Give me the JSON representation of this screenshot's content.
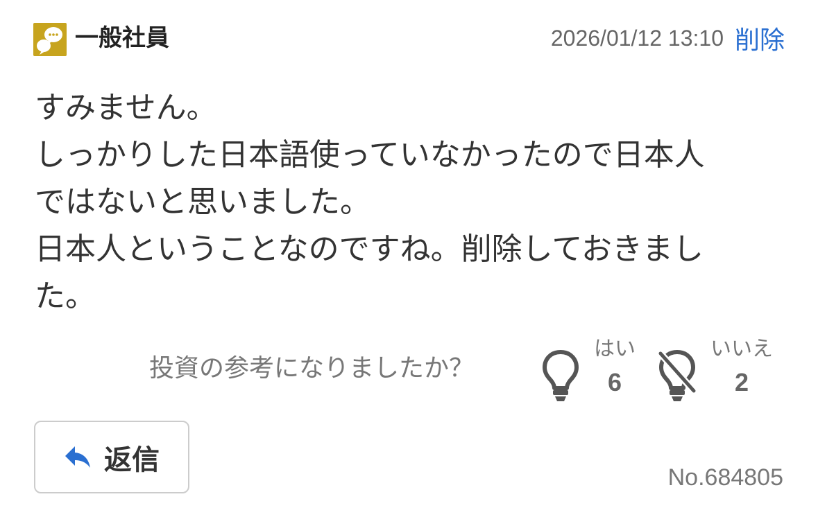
{
  "post": {
    "author": {
      "name": "一般社員",
      "avatar_icon": "chat-bubbles-icon",
      "avatar_color": "#c7a41e"
    },
    "timestamp": "2026/01/12 13:10",
    "delete_label": "削除",
    "body_lines": [
      "すみません。",
      "しっかりした日本語使っていなかったので日本人",
      "ではないと思いました。",
      "日本人ということなのですね。削除しておきまし",
      "た。"
    ],
    "post_number": "No.684805"
  },
  "feedback": {
    "question": "投資の参考になりましたか？",
    "yes": {
      "label": "はい",
      "count": "6",
      "icon": "lightbulb-icon"
    },
    "no": {
      "label": "いいえ",
      "count": "2",
      "icon": "lightbulb-off-icon"
    }
  },
  "actions": {
    "reply_label": "返信",
    "reply_icon": "reply-arrow-icon"
  },
  "colors": {
    "link": "#2a6fd1",
    "text": "#333333",
    "muted": "#777777",
    "avatar_bg": "#c7a41e"
  }
}
